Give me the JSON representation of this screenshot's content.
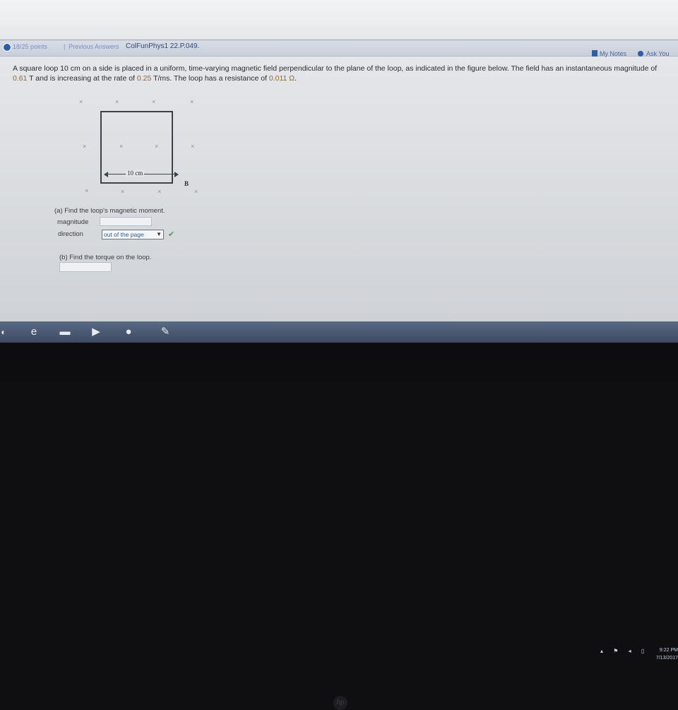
{
  "header": {
    "points": "18/25 points",
    "separator": "|",
    "previous_answers": "Previous Answers",
    "question_id": "ColFunPhys1 22.P.049."
  },
  "toolbar": {
    "my_notes": "My Notes",
    "ask": "Ask You"
  },
  "problem": {
    "text_1": "A square loop 10 cm on a side is placed in a uniform, time-varying magnetic field perpendicular to the plane of the loop, as indicated in the figure below. The field has an instantaneous magnitude of ",
    "field_value": "0.61",
    "text_2": " T and is increasing at the rate of ",
    "rate_value": "0.25",
    "text_3": " T/ms. The loop has a resistance of ",
    "resistance_value": "0.011 Ω",
    "text_4": "."
  },
  "figure": {
    "dimension_label": "10 cm",
    "field_label": "B",
    "marker": "×"
  },
  "part_a": {
    "prompt": "(a) Find the loop's magnetic moment.",
    "magnitude_label": "magnitude",
    "magnitude_value": "",
    "direction_label": "direction",
    "direction_value": "out of the page",
    "check": "✔"
  },
  "part_b": {
    "prompt": "(b) Find the torque on the loop.",
    "value": ""
  },
  "taskbar": {
    "clock_time": "9:22 PM",
    "clock_date": "7/13/2017"
  },
  "bezel": {
    "logo": "hp"
  }
}
